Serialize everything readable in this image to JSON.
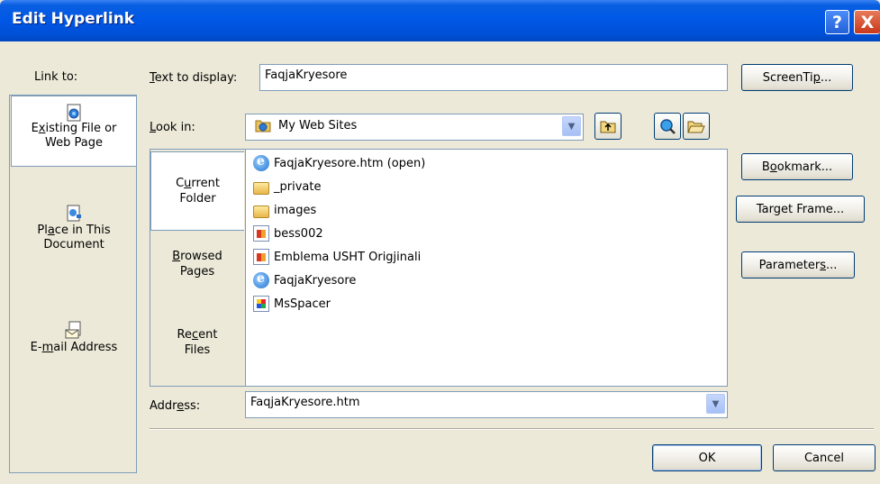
{
  "window": {
    "title": "Edit Hyperlink",
    "help_glyph": "?",
    "close_glyph": "X"
  },
  "link_to": {
    "label": "Link to:",
    "items": [
      {
        "line1_pre": "E",
        "line1_u": "x",
        "line1_post": "isting File or",
        "line2": "Web Page",
        "icon": "page-globe-icon",
        "selected": true
      },
      {
        "line1_pre": "Pl",
        "line1_u": "a",
        "line1_post": "ce in This",
        "line2": "Document",
        "icon": "document-icon",
        "selected": false
      },
      {
        "line1_pre": "E-",
        "line1_u": "m",
        "line1_post": "ail Address",
        "line2": "",
        "icon": "email-icon",
        "selected": false
      }
    ]
  },
  "text_display": {
    "label_u": "T",
    "label_rest": "ext to display:",
    "value": "FaqjaKryesore",
    "screentip_pre": "ScreenTi",
    "screentip_u": "p",
    "screentip_post": "..."
  },
  "look_in": {
    "label_u": "L",
    "label_rest": "ook in:",
    "value": "My Web Sites",
    "icon": "web-folder-icon"
  },
  "folder_tabs": [
    {
      "line1_pre": "C",
      "line1_u": "u",
      "line1_post": "rrent",
      "line2": "Folder",
      "selected": true
    },
    {
      "line1_pre": "",
      "line1_u": "B",
      "line1_post": "rowsed",
      "line2": "Pages",
      "selected": false
    },
    {
      "line1_pre": "Re",
      "line1_u": "c",
      "line1_post": "ent",
      "line2": "Files",
      "selected": false
    }
  ],
  "files": [
    {
      "name": "FaqjaKryesore.htm (open)",
      "icon": "ie-page-icon"
    },
    {
      "name": "_private",
      "icon": "folder-icon"
    },
    {
      "name": "images",
      "icon": "folder-icon"
    },
    {
      "name": "bess002",
      "icon": "image-file-icon"
    },
    {
      "name": "Emblema USHT Origjinali",
      "icon": "image-file-icon"
    },
    {
      "name": "FaqjaKryesore",
      "icon": "ie-page-icon"
    },
    {
      "name": "MsSpacer",
      "icon": "spacer-file-icon"
    }
  ],
  "address": {
    "label_pre": "Addr",
    "label_u": "e",
    "label_post": "ss:",
    "value": "FaqjaKryesore.htm"
  },
  "side_buttons": {
    "bookmark_pre": "B",
    "bookmark_u": "o",
    "bookmark_post": "okmark...",
    "target_pre": "Tar",
    "target_u": "g",
    "target_post": "et Frame...",
    "params_pre": "Parameter",
    "params_u": "s",
    "params_post": "..."
  },
  "footer": {
    "ok": "OK",
    "cancel": "Cancel"
  }
}
